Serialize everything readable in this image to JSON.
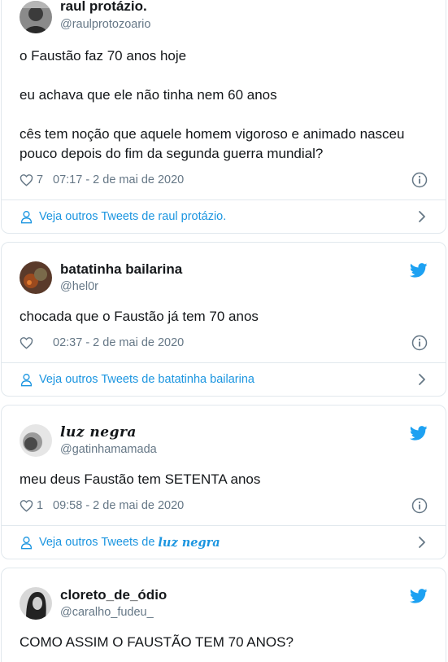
{
  "tweets": [
    {
      "name": "raul protázio.",
      "handle": "@raulprotozoario",
      "paragraphs": [
        "o Faustão faz 70 anos hoje",
        "eu achava que ele não tinha nem 60 anos",
        "cês tem noção que aquele homem vigoroso e animado nasceu pouco depois do fim da segunda guerra mundial?"
      ],
      "likes": "7",
      "timestamp": "07:17 - 2 de mai de 2020",
      "more_tweets": "Veja outros Tweets de raul protázio."
    },
    {
      "name": "batatinha bailarina",
      "handle": "@hel0r",
      "text": "chocada que o Faustão já tem 70 anos",
      "likes": "",
      "timestamp": "02:37 - 2 de mai de 2020",
      "more_tweets": "Veja outros Tweets de batatinha bailarina"
    },
    {
      "name": "luz negra",
      "handle": "@gatinhamamada",
      "text": "meu deus Faustão tem SETENTA anos",
      "likes": "1",
      "timestamp": "09:58 - 2 de mai de 2020",
      "more_tweets_prefix": "Veja outros Tweets de",
      "more_tweets_name": "luz negra"
    },
    {
      "name": "cloreto_de_ódio",
      "handle": "@caralho_fudeu_",
      "text": "COMO ASSIM O FAUSTÃO TEM 70 ANOS?"
    }
  ],
  "colors": {
    "text": "#14171a",
    "secondary": "#657786",
    "link": "#1b95e0",
    "twitter_blue": "#1da1f2",
    "border": "#e1e8ed"
  },
  "icons": [
    "heart-icon",
    "info-icon",
    "person-icon",
    "chevron-right-icon",
    "twitter-bird-icon"
  ]
}
